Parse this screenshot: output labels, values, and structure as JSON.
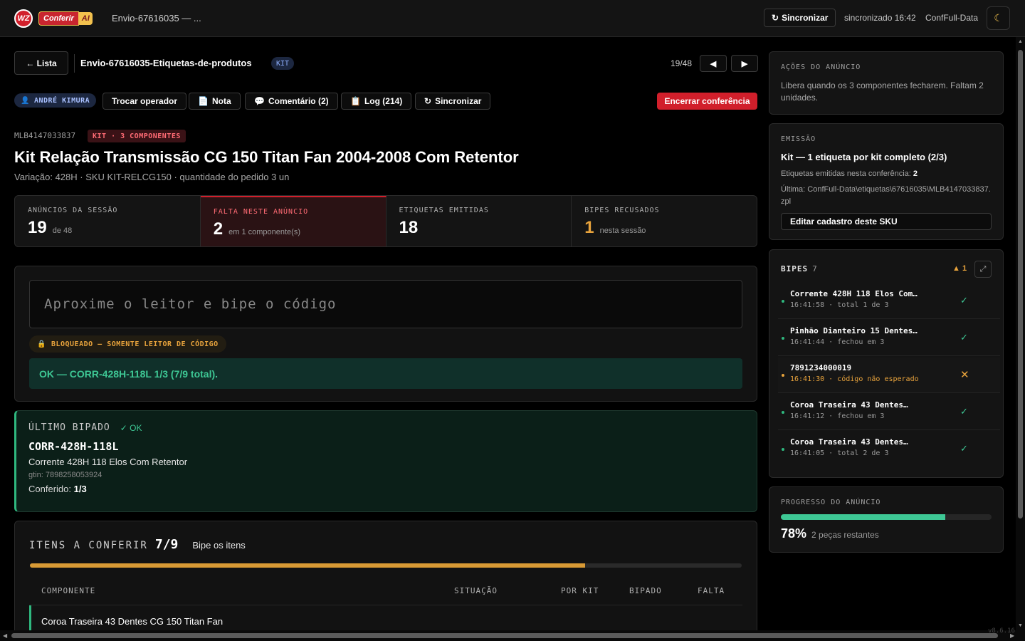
{
  "topbar": {
    "logo_text": "WZ",
    "brand_word": "Conferir",
    "brand_ai": "AI",
    "title": "Envio-67616035 — ...",
    "sync_label": "Sincronizar",
    "sync_status": "sincronizado 16:42",
    "user": "ConfFull-Data",
    "theme_icon": "moon-icon"
  },
  "header": {
    "back_label": "← Lista",
    "envio_title": "Envio-67616035-Etiquetas-de-produtos",
    "kit_tag": "KIT",
    "pager": "19/48",
    "prev_label": "◀",
    "next_label": "▶"
  },
  "actions": {
    "operator": "ANDRÉ KIMURA",
    "switch_operator": "Trocar operador",
    "note": "Nota",
    "comments": "Comentário (2)",
    "log": "Log (214)",
    "sync": "Sincronizar",
    "end": "Encerrar conferência"
  },
  "product": {
    "mlb": "MLB4147033837",
    "kit_badge": "KIT · 3 COMPONENTES",
    "title": "Kit Relação Transmissão CG 150 Titan Fan 2004-2008 Com Retentor",
    "subtitle": "Variação: 428H · SKU KIT-RELCG150 · quantidade do pedido 3 un"
  },
  "stats": [
    {
      "label": "ANÚNCIOS DA SESSÃO",
      "value": "19",
      "sub": "de 48"
    },
    {
      "label": "FALTA NESTE ANÚNCIO",
      "value": "2",
      "sub": "em 1 componente(s)"
    },
    {
      "label": "ETIQUETAS EMITIDAS",
      "value": "18",
      "sub": ""
    },
    {
      "label": "BIPES RECUSADOS",
      "value": "1",
      "sub": "nesta sessão"
    }
  ],
  "scan": {
    "placeholder": "Aproxime o leitor e bipe o código",
    "locked": "BLOQUEADO — SOMENTE LEITOR DE CÓDIGO",
    "message": "OK — CORR-428H-118L 1/3 (7/9 total)."
  },
  "last_scanned": {
    "label": "ÚLTIMO BIPADO",
    "status": "✓ OK",
    "code": "CORR-428H-118L",
    "name": "Corrente 428H 118 Elos Com Retentor",
    "gtin": "gtin: 7898258053924",
    "checked_label": "Conferido:",
    "checked_value": "1/3"
  },
  "items": {
    "title": "ITENS A CONFERIR",
    "count": "7/9",
    "hint": "Bipe os itens",
    "progress": 0.78,
    "columns": [
      "COMPONENTE",
      "SITUAÇÃO",
      "POR KIT",
      "BIPADO",
      "FALTA"
    ],
    "first_row": "Coroa Traseira 43 Dentes CG 150 Titan Fan"
  },
  "acoes": {
    "label": "AÇÕES DO ANÚNCIO",
    "text": "Libera quando os 3 componentes fecharem. Faltam 2 unidades."
  },
  "emissao": {
    "label": "EMISSÃO",
    "title": "Kit — 1 etiqueta por kit completo (2/3)",
    "emitted_label": "Etiquetas emitidas nesta conferência:",
    "emitted_value": "2",
    "last_path": "Última: ConfFull-Data\\etiquetas\\67616035\\MLB4147033837.zpl",
    "edit": "Editar cadastro deste SKU"
  },
  "bipes": {
    "label": "BIPES",
    "count": "7",
    "warn_count": "1",
    "list": [
      {
        "name": "Corrente 428H 118 Elos Com…",
        "meta": "16:41:58 · total 1 de 3",
        "status": "✓",
        "error": false
      },
      {
        "name": "Pinhão Dianteiro 15 Dentes…",
        "meta": "16:41:44 · fechou em 3",
        "status": "✓",
        "error": false
      },
      {
        "name": "7891234000019",
        "meta": "16:41:30 · código não esperado",
        "status": "✕",
        "error": true
      },
      {
        "name": "Coroa Traseira 43 Dentes…",
        "meta": "16:41:12 · fechou em 3",
        "status": "✓",
        "error": false
      },
      {
        "name": "Coroa Traseira 43 Dentes…",
        "meta": "16:41:05 · total 2 de 3",
        "status": "✓",
        "error": false
      }
    ]
  },
  "progresso": {
    "label": "PROGRESSO DO ANÚNCIO",
    "value": 0.78,
    "percent": "78%",
    "remaining": "2 peças restantes"
  },
  "version": "v8.6.16",
  "colors": {
    "accent": "#d11f2b",
    "ok": "#3ec895",
    "warn": "#e8a33c",
    "info": "#8fb1ff"
  }
}
